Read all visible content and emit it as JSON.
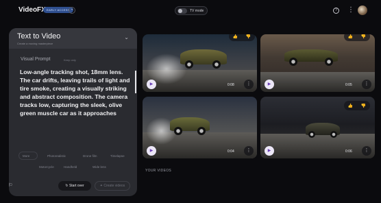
{
  "header": {
    "brand": "VideoFX",
    "badge": "EARLY ACCESS",
    "toggle_label": "TV mode",
    "help_icon": "help-circle-icon",
    "more_icon": "more-vertical-icon"
  },
  "panel": {
    "title": "Text to Video",
    "subtitle": "Create a moving masterpiece",
    "prompt_label": "Visual Prompt",
    "prompt_tag": "Keep only",
    "prompt_text": "Low-angle tracking shot, 18mm lens. The car drifts, leaving trails of light and tire smoke, creating a visually striking and abstract composition. The camera tracks low, capturing the sleek, olive green muscle car as it approaches",
    "chips_row1": [
      "More",
      "Photorealistic",
      "Drone film",
      "Timelapse"
    ],
    "chips_row2": [
      "Motorcycle",
      "Handheld",
      "Wide lens"
    ],
    "start_over": "Start over",
    "create_videos": "Create videos"
  },
  "videos": [
    {
      "time": "0:08"
    },
    {
      "time": "0:05"
    },
    {
      "time": "0:04"
    },
    {
      "time": "0:06"
    }
  ],
  "section_label": "YOUR VIDEOS",
  "colors": {
    "background": "#0b0b0e",
    "panel": "#2a2b30",
    "accent": "#6a3fb5",
    "badge": "#2f4f8f"
  }
}
